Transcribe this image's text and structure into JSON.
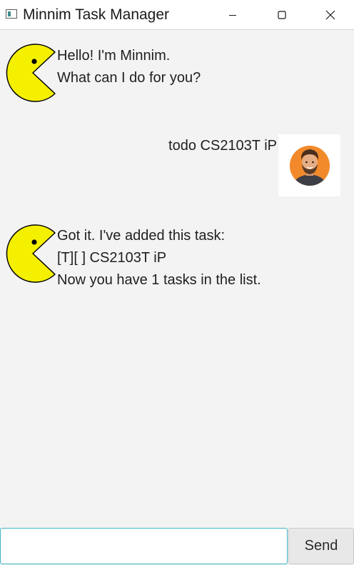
{
  "window": {
    "title": "Minnim Task Manager"
  },
  "chat": {
    "messages": [
      {
        "sender": "bot",
        "lines": [
          "Hello! I'm Minnim.",
          "What can I do for you?"
        ]
      },
      {
        "sender": "user",
        "lines": [
          "todo CS2103T iP"
        ]
      },
      {
        "sender": "bot",
        "lines": [
          "Got it. I've added this task:",
          "[T][ ] CS2103T iP",
          "Now you have 1 tasks in the list."
        ]
      }
    ]
  },
  "input": {
    "value": "",
    "send_label": "Send"
  },
  "colors": {
    "pacman_yellow": "#f5f000",
    "user_avatar_orange": "#f07a1c",
    "input_focus": "#3fb3c4"
  }
}
